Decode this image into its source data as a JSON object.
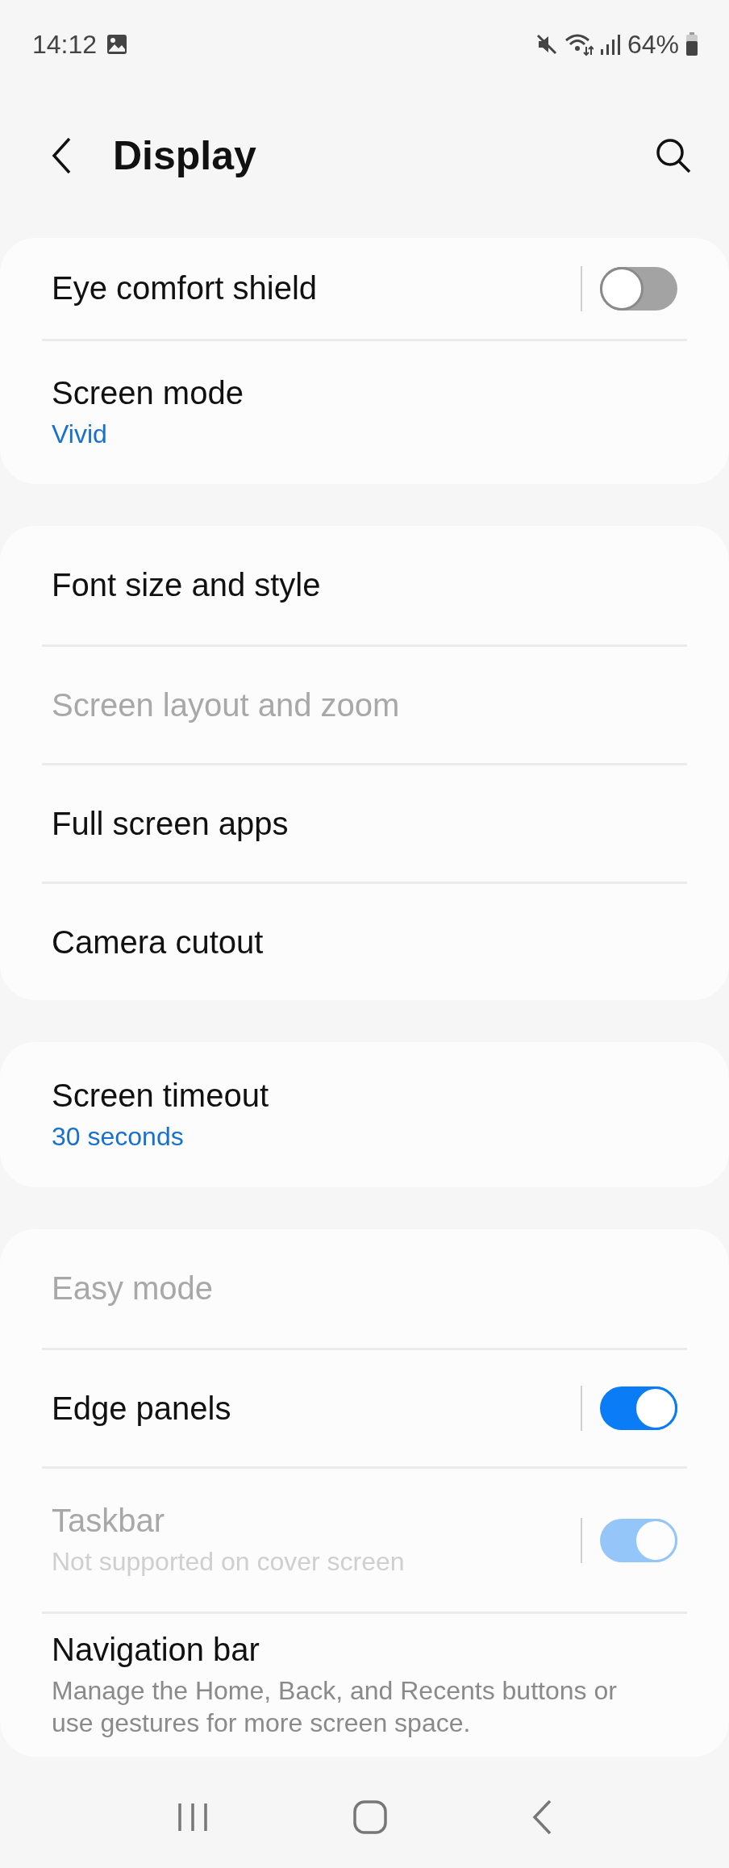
{
  "status_bar": {
    "time": "14:12",
    "battery": "64%"
  },
  "header": {
    "title": "Display"
  },
  "groups": [
    {
      "items": [
        {
          "kind": "toggle",
          "title": "Eye comfort shield",
          "disabled": false,
          "on": false
        },
        {
          "kind": "link",
          "title": "Screen mode",
          "summary": {
            "kind": "value",
            "text": "Vivid"
          },
          "disabled": false
        }
      ]
    },
    {
      "items": [
        {
          "kind": "link",
          "title": "Font size and style",
          "disabled": false
        },
        {
          "kind": "link",
          "title": "Screen layout and zoom",
          "disabled": true
        },
        {
          "kind": "link",
          "title": "Full screen apps",
          "disabled": false
        },
        {
          "kind": "link",
          "title": "Camera cutout",
          "disabled": false
        }
      ]
    },
    {
      "items": [
        {
          "kind": "link",
          "title": "Screen timeout",
          "summary": {
            "kind": "value",
            "text": "30 seconds"
          },
          "disabled": false
        }
      ]
    },
    {
      "items": [
        {
          "kind": "link",
          "title": "Easy mode",
          "disabled": true
        },
        {
          "kind": "toggle",
          "title": "Edge panels",
          "disabled": false,
          "on": true
        },
        {
          "kind": "toggle",
          "title": "Taskbar",
          "summary": {
            "kind": "description",
            "text": "Not supported on cover screen"
          },
          "disabled": true,
          "on": true
        },
        {
          "kind": "link",
          "title": "Navigation bar",
          "summary": {
            "kind": "description",
            "text": "Manage the Home, Back, and Recents buttons or use gestures for more screen space."
          },
          "disabled": false
        }
      ]
    }
  ]
}
